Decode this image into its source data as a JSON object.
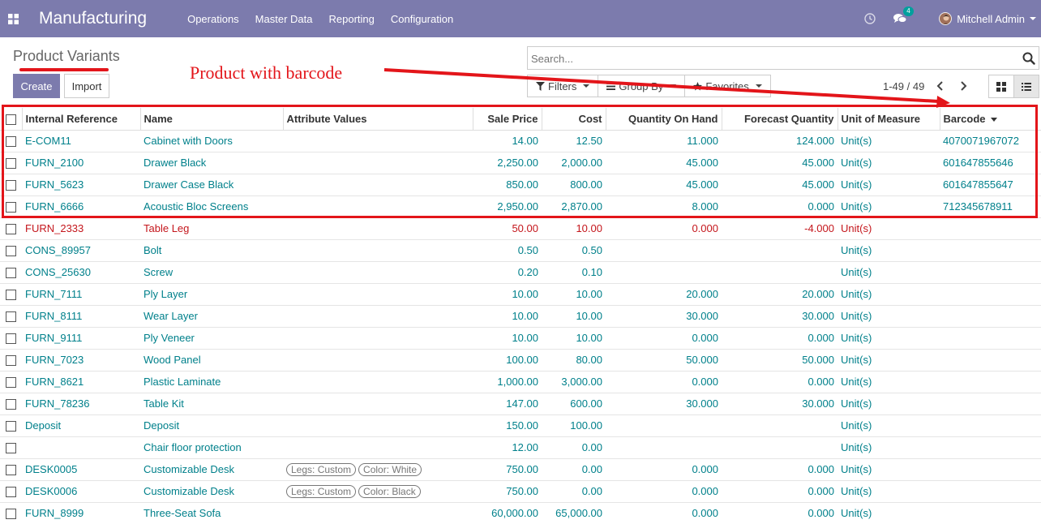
{
  "navbar": {
    "app_name": "Manufacturing",
    "menu": [
      "Operations",
      "Master Data",
      "Reporting",
      "Configuration"
    ],
    "chat_count": "4",
    "user_name": "Mitchell Admin",
    "color": "#7c7bad"
  },
  "control_panel": {
    "breadcrumb": "Product Variants",
    "create_label": "Create",
    "import_label": "Import",
    "search_placeholder": "Search...",
    "filters_label": "Filters",
    "group_by_label": "Group By",
    "favorites_label": "Favorites",
    "pager": "1-49 / 49"
  },
  "annotation": {
    "text": "Product with barcode",
    "color": "#e3151a"
  },
  "table": {
    "columns": [
      "Internal Reference",
      "Name",
      "Attribute Values",
      "Sale Price",
      "Cost",
      "Quantity On Hand",
      "Forecast Quantity",
      "Unit of Measure",
      "Barcode"
    ],
    "rows": [
      {
        "ref": "E-COM11",
        "name": "Cabinet with Doors",
        "attrs": [],
        "price": "14.00",
        "cost": "12.50",
        "qoh": "11.000",
        "forecast": "124.000",
        "uom": "Unit(s)",
        "barcode": "4070071967072"
      },
      {
        "ref": "FURN_2100",
        "name": "Drawer Black",
        "attrs": [],
        "price": "2,250.00",
        "cost": "2,000.00",
        "qoh": "45.000",
        "forecast": "45.000",
        "uom": "Unit(s)",
        "barcode": "601647855646"
      },
      {
        "ref": "FURN_5623",
        "name": "Drawer Case Black",
        "attrs": [],
        "price": "850.00",
        "cost": "800.00",
        "qoh": "45.000",
        "forecast": "45.000",
        "uom": "Unit(s)",
        "barcode": "601647855647"
      },
      {
        "ref": "FURN_6666",
        "name": "Acoustic Bloc Screens",
        "attrs": [],
        "price": "2,950.00",
        "cost": "2,870.00",
        "qoh": "8.000",
        "forecast": "0.000",
        "uom": "Unit(s)",
        "barcode": "712345678911"
      },
      {
        "ref": "FURN_2333",
        "name": "Table Leg",
        "attrs": [],
        "price": "50.00",
        "cost": "10.00",
        "qoh": "0.000",
        "forecast": "-4.000",
        "uom": "Unit(s)",
        "barcode": "",
        "negative": true
      },
      {
        "ref": "CONS_89957",
        "name": "Bolt",
        "attrs": [],
        "price": "0.50",
        "cost": "0.50",
        "qoh": "",
        "forecast": "",
        "uom": "Unit(s)",
        "barcode": ""
      },
      {
        "ref": "CONS_25630",
        "name": "Screw",
        "attrs": [],
        "price": "0.20",
        "cost": "0.10",
        "qoh": "",
        "forecast": "",
        "uom": "Unit(s)",
        "barcode": ""
      },
      {
        "ref": "FURN_7111",
        "name": "Ply Layer",
        "attrs": [],
        "price": "10.00",
        "cost": "10.00",
        "qoh": "20.000",
        "forecast": "20.000",
        "uom": "Unit(s)",
        "barcode": ""
      },
      {
        "ref": "FURN_8111",
        "name": "Wear Layer",
        "attrs": [],
        "price": "10.00",
        "cost": "10.00",
        "qoh": "30.000",
        "forecast": "30.000",
        "uom": "Unit(s)",
        "barcode": ""
      },
      {
        "ref": "FURN_9111",
        "name": "Ply Veneer",
        "attrs": [],
        "price": "10.00",
        "cost": "10.00",
        "qoh": "0.000",
        "forecast": "0.000",
        "uom": "Unit(s)",
        "barcode": ""
      },
      {
        "ref": "FURN_7023",
        "name": "Wood Panel",
        "attrs": [],
        "price": "100.00",
        "cost": "80.00",
        "qoh": "50.000",
        "forecast": "50.000",
        "uom": "Unit(s)",
        "barcode": ""
      },
      {
        "ref": "FURN_8621",
        "name": "Plastic Laminate",
        "attrs": [],
        "price": "1,000.00",
        "cost": "3,000.00",
        "qoh": "0.000",
        "forecast": "0.000",
        "uom": "Unit(s)",
        "barcode": ""
      },
      {
        "ref": "FURN_78236",
        "name": "Table Kit",
        "attrs": [],
        "price": "147.00",
        "cost": "600.00",
        "qoh": "30.000",
        "forecast": "30.000",
        "uom": "Unit(s)",
        "barcode": ""
      },
      {
        "ref": "Deposit",
        "name": "Deposit",
        "attrs": [],
        "price": "150.00",
        "cost": "100.00",
        "qoh": "",
        "forecast": "",
        "uom": "Unit(s)",
        "barcode": ""
      },
      {
        "ref": "",
        "name": "Chair floor protection",
        "attrs": [],
        "price": "12.00",
        "cost": "0.00",
        "qoh": "",
        "forecast": "",
        "uom": "Unit(s)",
        "barcode": ""
      },
      {
        "ref": "DESK0005",
        "name": "Customizable Desk",
        "attrs": [
          "Legs: Custom",
          "Color: White"
        ],
        "price": "750.00",
        "cost": "0.00",
        "qoh": "0.000",
        "forecast": "0.000",
        "uom": "Unit(s)",
        "barcode": ""
      },
      {
        "ref": "DESK0006",
        "name": "Customizable Desk",
        "attrs": [
          "Legs: Custom",
          "Color: Black"
        ],
        "price": "750.00",
        "cost": "0.00",
        "qoh": "0.000",
        "forecast": "0.000",
        "uom": "Unit(s)",
        "barcode": ""
      },
      {
        "ref": "FURN_8999",
        "name": "Three-Seat Sofa",
        "attrs": [],
        "price": "60,000.00",
        "cost": "65,000.00",
        "qoh": "0.000",
        "forecast": "0.000",
        "uom": "Unit(s)",
        "barcode": ""
      }
    ]
  }
}
